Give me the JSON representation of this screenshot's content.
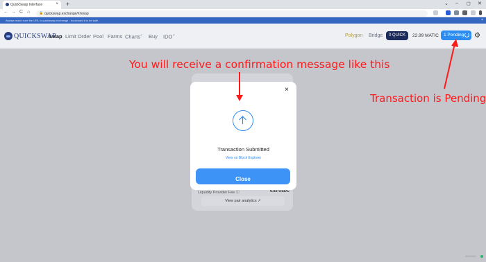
{
  "browser": {
    "tab_title": "QuickSwap Interface",
    "tab_close": "×",
    "new_tab": "+",
    "window_controls": [
      "⌄",
      "–",
      "◻",
      "✕"
    ],
    "nav": {
      "back": "←",
      "forward": "→",
      "reload": "C",
      "home": "⌂"
    },
    "lock": "🔒",
    "url": "quickswap.exchange/#/swap",
    "infobar_text": "Always make sure the URL is quickswap.exchange - bookmark it to be safe.",
    "infobar_close": "×"
  },
  "header": {
    "logo_text": "QUICKSWAP",
    "menu": [
      {
        "label": "Swap",
        "sup": ""
      },
      {
        "label": "Limit Order",
        "sup": ""
      },
      {
        "label": "Pool",
        "sup": ""
      },
      {
        "label": "Farms",
        "sup": ""
      },
      {
        "label": "Charts",
        "sup": "↗"
      },
      {
        "label": "Buy",
        "sup": ""
      },
      {
        "label": "IDO",
        "sup": "↗"
      }
    ],
    "network": "Polygon",
    "bridge": "Bridge",
    "quick_balance": "0 QUICK",
    "matic_balance": "22.99 MATIC",
    "pending": "1 Pending",
    "settings_icon": "⚙"
  },
  "background": {
    "lp_fee_label": "Liquidity Provider Fee ⓘ",
    "lp_fee_value": "6.83 USDC",
    "pair_analytics": "View pair analytics ↗",
    "corner_status": "0000000"
  },
  "modal": {
    "close_icon": "×",
    "title": "Transaction Submitted",
    "explorer_link": "View on Block Explorer",
    "close_button": "Close"
  },
  "annotations": {
    "top": "You will receive a confirmation message like this",
    "right": "Transaction is Pending",
    "color": "#ff1a1a"
  },
  "colors": {
    "brand": "#2a3d7c",
    "accent": "#2d8cf0",
    "quick_pill": "#1b2b5c",
    "infobar": "#3466c2"
  }
}
